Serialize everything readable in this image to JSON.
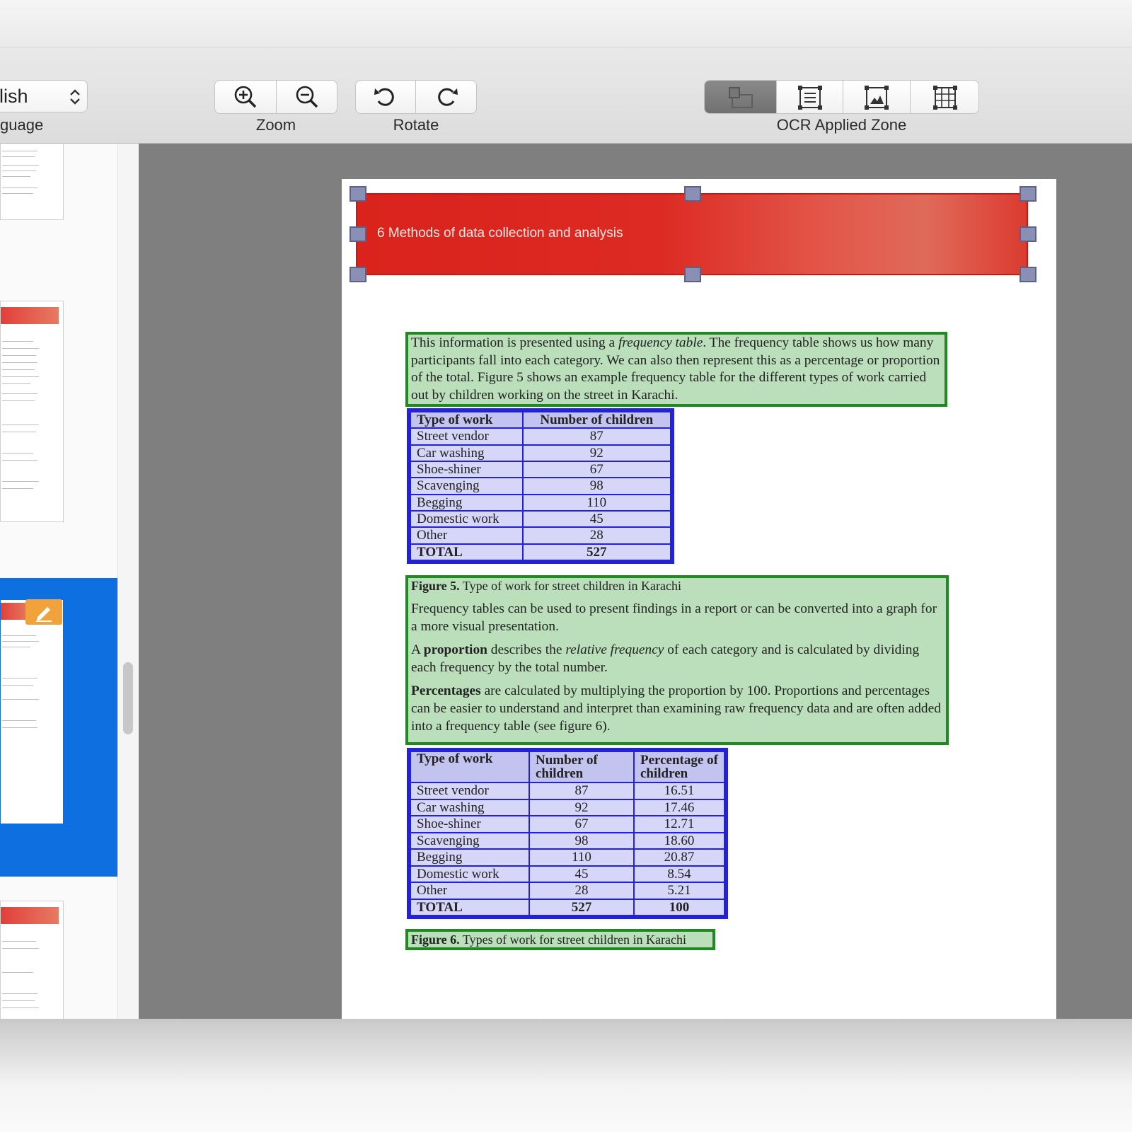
{
  "toolbar": {
    "language_value": "lish",
    "language_label": "guage",
    "zoom_label": "Zoom",
    "rotate_label": "Rotate",
    "ocr_zone_label": "OCR Applied Zone"
  },
  "icons": {
    "zoom_in": "zoom-in-icon",
    "zoom_out": "zoom-out-icon",
    "rotate_left": "rotate-left-icon",
    "rotate_right": "rotate-right-icon",
    "zone_auto": "auto-zone-icon",
    "zone_text": "text-zone-icon",
    "zone_image": "image-zone-icon",
    "zone_table": "table-zone-icon"
  },
  "colors": {
    "selection_blue": "#0d6fe0",
    "text_zone_green": "#1f8a1f",
    "table_zone_blue": "#2222dd",
    "header_red": "#d9231c"
  },
  "document": {
    "header_title": "6 Methods of data collection and analysis",
    "para1_a": "This information is presented using a ",
    "para1_em": "frequency table",
    "para1_b": ". The frequency table shows us how many participants fall into each category. We can also then represent this as a percentage or proportion of the total. Figure 5 shows an example frequency table for the different types of work carried out by children working on the street in Karachi.",
    "table1": {
      "headers": [
        "Type of work",
        "Number of children"
      ],
      "rows": [
        [
          "Street vendor",
          "87"
        ],
        [
          "Car washing",
          "92"
        ],
        [
          "Shoe-shiner",
          "67"
        ],
        [
          "Scavenging",
          "98"
        ],
        [
          "Begging",
          "110"
        ],
        [
          "Domestic work",
          "45"
        ],
        [
          "Other",
          "28"
        ],
        [
          "TOTAL",
          "527"
        ]
      ]
    },
    "fig5_bold": "Figure 5.",
    "fig5_text": " Type of work for street children in Karachi",
    "para2": "Frequency tables can be used to present findings in a report or can be converted into a graph for a more visual presentation.",
    "para3_a": "A ",
    "para3_bold": "proportion",
    "para3_b": " describes the ",
    "para3_em": "relative frequency",
    "para3_c": " of each category and is calculated by dividing each frequency by the total number.",
    "para4_bold": "Percentages",
    "para4_b": " are calculated by multiplying the proportion by 100. Proportions and percentages can be easier to understand and interpret than examining raw frequency data and are often added into a frequency table (see figure 6).",
    "table2": {
      "headers": [
        "Type of work",
        "Number of children",
        "Percentage of children"
      ],
      "rows": [
        [
          "Street vendor",
          "87",
          "16.51"
        ],
        [
          "Car washing",
          "92",
          "17.46"
        ],
        [
          "Shoe-shiner",
          "67",
          "12.71"
        ],
        [
          "Scavenging",
          "98",
          "18.60"
        ],
        [
          "Begging",
          "110",
          "20.87"
        ],
        [
          "Domestic work",
          "45",
          "8.54"
        ],
        [
          "Other",
          "28",
          "5.21"
        ],
        [
          "TOTAL",
          "527",
          "100"
        ]
      ]
    },
    "fig6_bold": "Figure 6.",
    "fig6_text": " Types of work for street children in Karachi"
  }
}
